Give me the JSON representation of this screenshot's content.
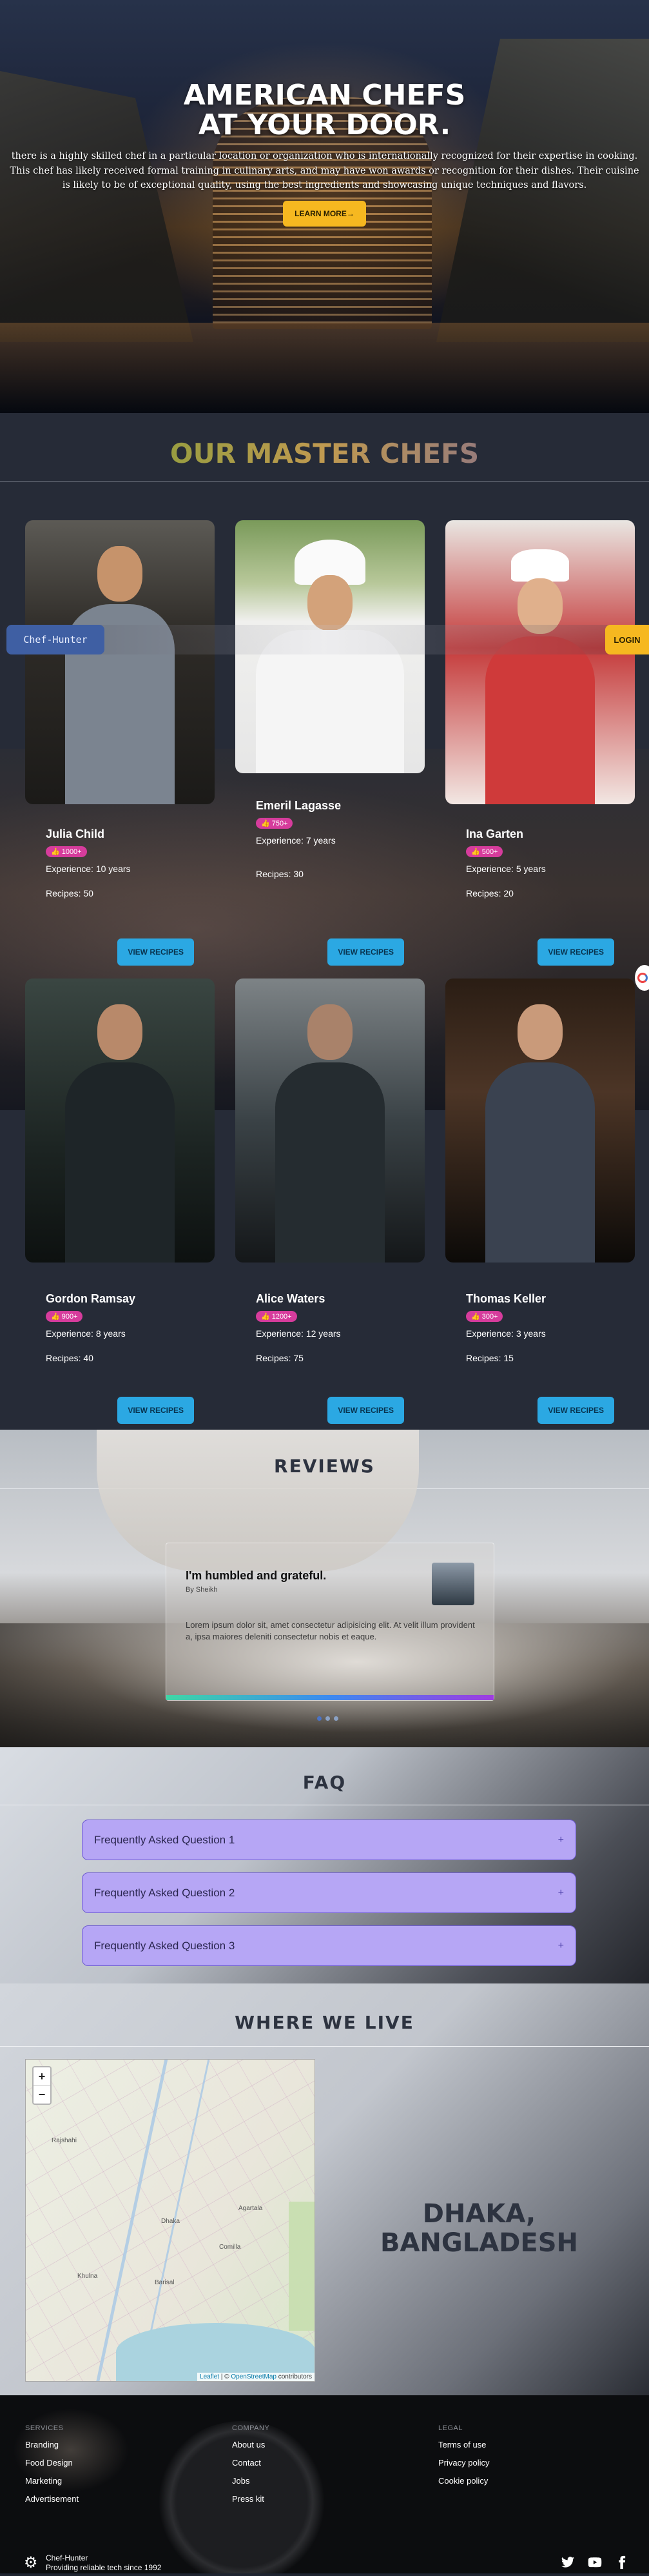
{
  "hero": {
    "title_line1": "AMERICAN CHEFS",
    "title_line2": "AT YOUR DOOR.",
    "description": "there is a highly skilled chef in a particular location or organization who is internationally recognized for their expertise in cooking. This chef has likely received formal training in culinary arts, and may have won awards or recognition for their dishes. Their cuisine is likely to be of exceptional quality, using the best ingredients and showcasing unique techniques and flavors.",
    "cta_label": "LEARN MORE",
    "cta_arrow": "→"
  },
  "nav": {
    "logo_label": "Chef-Hunter",
    "login_label": "LOGIN"
  },
  "chefs_section": {
    "title": "OUR MASTER CHEFS",
    "chefs": [
      {
        "name": "Julia Child",
        "likes": "1000+",
        "experience": "Experience: 10 years",
        "recipes": "Recipes: 50",
        "button": "VIEW RECIPES"
      },
      {
        "name": "Emeril Lagasse",
        "likes": "750+",
        "experience": "Experience: 7 years",
        "recipes": "Recipes: 30",
        "button": "VIEW RECIPES"
      },
      {
        "name": "Ina Garten",
        "likes": "500+",
        "experience": "Experience: 5 years",
        "recipes": "Recipes: 20",
        "button": "VIEW RECIPES"
      },
      {
        "name": "Gordon Ramsay",
        "likes": "900+",
        "experience": "Experience: 8 years",
        "recipes": "Recipes: 40",
        "button": "VIEW RECIPES"
      },
      {
        "name": "Alice Waters",
        "likes": "1200+",
        "experience": "Experience: 12 years",
        "recipes": "Recipes: 75",
        "button": "VIEW RECIPES"
      },
      {
        "name": "Thomas Keller",
        "likes": "300+",
        "experience": "Experience: 3 years",
        "recipes": "Recipes: 15",
        "button": "VIEW RECIPES"
      }
    ],
    "badge_icon": "thumbs-up-icon"
  },
  "reviews": {
    "title": "REVIEWS",
    "headline": "I'm humbled and grateful.",
    "author": "By Sheikh",
    "body": "Lorem ipsum dolor sit, amet consectetur adipisicing elit. At velit illum provident a, ipsa maiores deleniti consectetur nobis et eaque.",
    "dots": 3,
    "active_dot": 1
  },
  "faq": {
    "title": "FAQ",
    "items": [
      {
        "question": "Frequently Asked Question 1",
        "icon": "+"
      },
      {
        "question": "Frequently Asked Question 2",
        "icon": "+"
      },
      {
        "question": "Frequently Asked Question 3",
        "icon": "+"
      }
    ]
  },
  "location": {
    "title": "WHERE WE LIVE",
    "city_line1": "DHAKA,",
    "city_line2": "BANGLADESH",
    "map": {
      "zoom_in": "+",
      "zoom_out": "−",
      "attribution_leaflet": "Leaflet",
      "attribution_sep": " | © ",
      "attribution_osm": "OpenStreetMap",
      "attribution_tail": " contributors",
      "places": [
        "Agartala",
        "Dhaka",
        "Comilla",
        "Barisal",
        "Khulna",
        "Rajshahi"
      ]
    }
  },
  "footer": {
    "columns": [
      {
        "heading": "SERVICES",
        "links": [
          "Branding",
          "Food Design",
          "Marketing",
          "Advertisement"
        ]
      },
      {
        "heading": "COMPANY",
        "links": [
          "About us",
          "Contact",
          "Jobs",
          "Press kit"
        ]
      },
      {
        "heading": "LEGAL",
        "links": [
          "Terms of use",
          "Privacy policy",
          "Cookie policy"
        ]
      }
    ],
    "brand_name": "Chef-Hunter",
    "brand_tagline": "Providing reliable tech since 1992",
    "social": [
      "twitter-icon",
      "youtube-icon",
      "facebook-icon"
    ]
  }
}
